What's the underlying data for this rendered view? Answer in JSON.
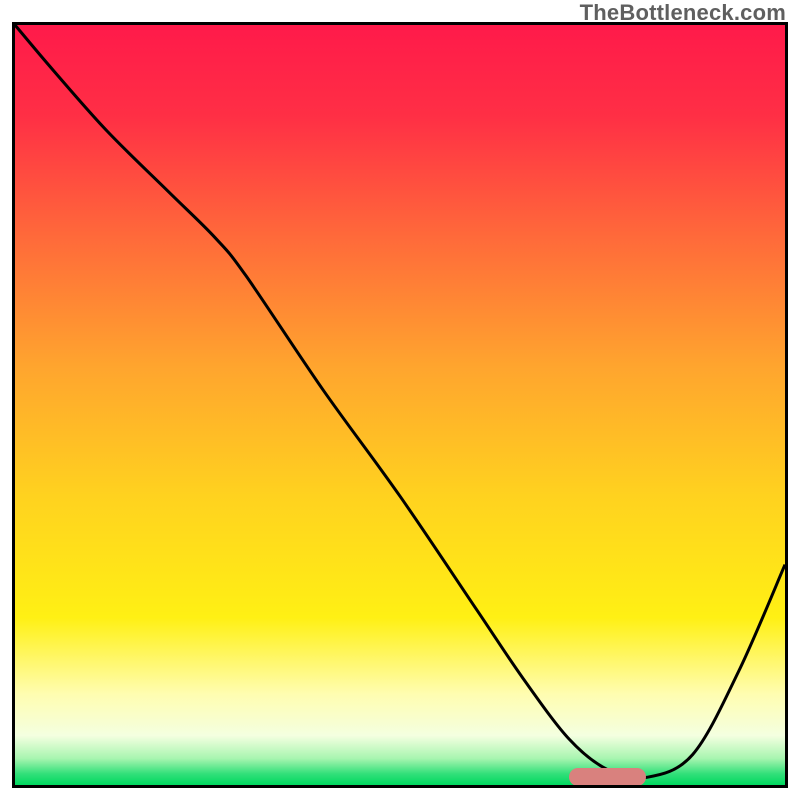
{
  "watermark": "TheBottleneck.com",
  "chart_data": {
    "type": "line",
    "title": "",
    "xlabel": "",
    "ylabel": "",
    "xlim": [
      0,
      100
    ],
    "ylim": [
      0,
      100
    ],
    "x": [
      0,
      5,
      12,
      20,
      26,
      30,
      40,
      50,
      60,
      66,
      72,
      77,
      82,
      88,
      94,
      100
    ],
    "values": [
      100,
      94,
      86,
      78,
      72,
      67,
      52,
      38,
      23,
      14,
      6,
      2,
      1,
      4,
      15,
      29
    ],
    "gradient_stops": [
      {
        "offset": 0.0,
        "color": "#ff1a4a"
      },
      {
        "offset": 0.12,
        "color": "#ff2f45"
      },
      {
        "offset": 0.28,
        "color": "#ff6a3a"
      },
      {
        "offset": 0.45,
        "color": "#ffa52e"
      },
      {
        "offset": 0.62,
        "color": "#ffd21f"
      },
      {
        "offset": 0.78,
        "color": "#fff014"
      },
      {
        "offset": 0.88,
        "color": "#fffdb0"
      },
      {
        "offset": 0.935,
        "color": "#f4ffe0"
      },
      {
        "offset": 0.965,
        "color": "#a8f5b0"
      },
      {
        "offset": 0.985,
        "color": "#33e07a"
      },
      {
        "offset": 1.0,
        "color": "#00d85f"
      }
    ],
    "optimum_band": {
      "x_start": 72,
      "x_end": 82,
      "y": 1
    }
  }
}
